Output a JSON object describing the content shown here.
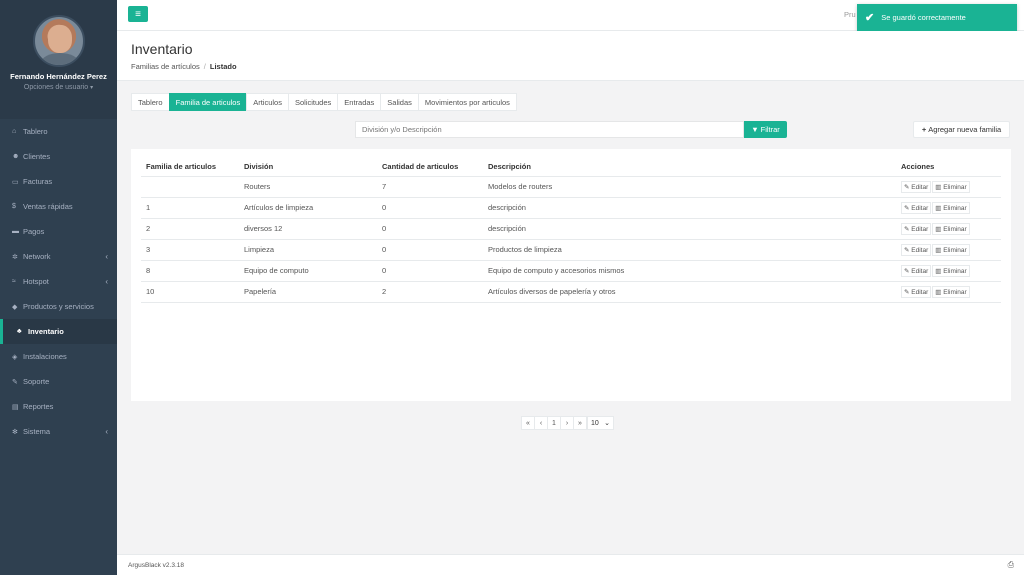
{
  "user": {
    "name": "Fernando Hernández Perez",
    "options": "Opciones de usuario"
  },
  "menu": [
    {
      "label": "Tablero",
      "icon": "dashboard-icon",
      "glyph": "⌂"
    },
    {
      "label": "Clientes",
      "icon": "users-icon",
      "glyph": "☻"
    },
    {
      "label": "Facturas",
      "icon": "file-icon",
      "glyph": "▭"
    },
    {
      "label": "Ventas rápidas",
      "icon": "dollar-icon",
      "glyph": "$"
    },
    {
      "label": "Pagos",
      "icon": "money-icon",
      "glyph": "▬"
    },
    {
      "label": "Network",
      "icon": "network-icon",
      "glyph": "✲"
    },
    {
      "label": "Hotspot",
      "icon": "wifi-icon",
      "glyph": "≈"
    },
    {
      "label": "Productos y servicios",
      "icon": "tags-icon",
      "glyph": "◆"
    },
    {
      "label": "Inventario",
      "icon": "cubes-icon",
      "glyph": "♣"
    },
    {
      "label": "Instalaciones",
      "icon": "tools-icon",
      "glyph": "◈"
    },
    {
      "label": "Soporte",
      "icon": "wrench-icon",
      "glyph": "✎"
    },
    {
      "label": "Reportes",
      "icon": "book-icon",
      "glyph": "▤"
    },
    {
      "label": "Sistema",
      "icon": "cogs-icon",
      "glyph": "✻"
    }
  ],
  "topbar": {
    "user_text": "Pru"
  },
  "toast": {
    "message": "Se guardó correctamente"
  },
  "page": {
    "title": "Inventario",
    "breadcrumb_parent": "Familias de artículos",
    "breadcrumb_current": "Listado"
  },
  "tabs": [
    "Tablero",
    "Familia de articulos",
    "Articulos",
    "Solicitudes",
    "Entradas",
    "Salidas",
    "Movimientos por articulos"
  ],
  "filter": {
    "placeholder": "División y/o Descripción",
    "button": "Filtrar"
  },
  "add_button": "Agregar nueva familia",
  "table": {
    "headers": [
      "Familia de articulos",
      "División",
      "Cantidad de articulos",
      "Descripción",
      "Acciones"
    ],
    "rows": [
      {
        "familia": "",
        "division": "Routers",
        "cantidad": "7",
        "descripcion": "Modelos de routers"
      },
      {
        "familia": "1",
        "division": "Artículos de limpieza",
        "cantidad": "0",
        "descripcion": "descripción"
      },
      {
        "familia": "2",
        "division": "diversos 12",
        "cantidad": "0",
        "descripcion": "descripción"
      },
      {
        "familia": "3",
        "division": "Limpieza",
        "cantidad": "0",
        "descripcion": "Productos de limpieza"
      },
      {
        "familia": "8",
        "division": "Equipo de computo",
        "cantidad": "0",
        "descripcion": "Equipo de computo y accesorios mismos"
      },
      {
        "familia": "10",
        "division": "Papelería",
        "cantidad": "2",
        "descripcion": "Artículos diversos de papelería y otros"
      }
    ],
    "edit_label": "Editar",
    "delete_label": "Eliminar"
  },
  "pagination": {
    "first": "«",
    "prev": "‹",
    "page": "1",
    "next": "›",
    "last": "»",
    "per_page": "10"
  },
  "footer": {
    "version": "ArgusBlack v2.3.18"
  },
  "colors": {
    "accent": "#1ab394",
    "sidebar": "#2f4050"
  }
}
